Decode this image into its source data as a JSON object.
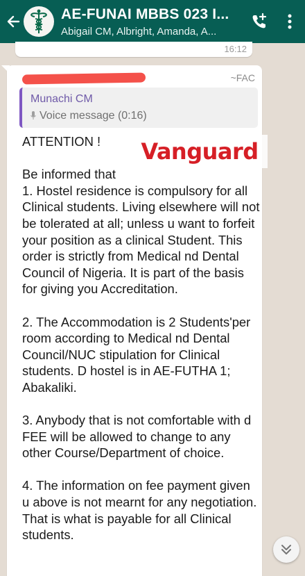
{
  "header": {
    "back_glyph": "←",
    "title": "AE-FUNAI MBBS 023  I...",
    "subtitle": "Abigail CM, Albright, Amanda, A...",
    "icons": [
      "back-arrow-icon",
      "group-avatar-caduceus",
      "add-call-icon",
      "more-vertical-icon"
    ],
    "colors": {
      "bar": "#075e54",
      "chat_bg": "#e4dcd3",
      "quote_bar": "#7e57c2",
      "watermark": "#d61f26"
    }
  },
  "previous_message": {
    "time": "16:12"
  },
  "message": {
    "sender_tag": "~FAC",
    "quoted": {
      "author": "Munachi CM",
      "text": "Voice message (0:16)"
    },
    "paragraphs": [
      "ATTENTION !",
      "Be informed that\n1. Hostel residence is compulsory for all Clinical students. Living elsewhere will not be tolerated at all; unless u want to forfeit your  position as a clinical Student. This order is strictly from Medical nd Dental Council of Nigeria. It is part of the basis for giving you Accreditation.",
      "2. The Accommodation is 2 Students'per room according to Medical nd Dental Council/NUC stipulation for Clinical students. D hostel is in AE-FUTHA 1; Abakaliki.",
      "3.  Anybody that is not comfortable with d FEE will be allowed to change to any other Course/Department of choice.",
      "4. The information on fee payment given u above is not mearnt for any negotiation. That is what is payable for all Clinical students."
    ]
  },
  "watermark": "Vanguard"
}
